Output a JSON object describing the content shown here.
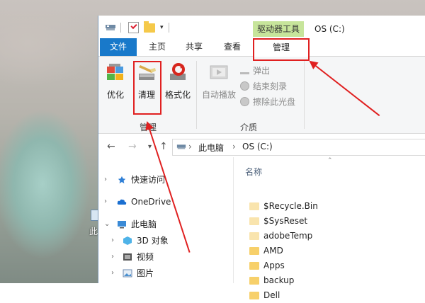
{
  "desktop": {
    "icon_label": "此电脑"
  },
  "titlebar": {
    "context_tab_label": "驱动器工具",
    "window_title": "OS (C:)",
    "qa_dropdown": "▾"
  },
  "tabs": {
    "file": "文件",
    "home": "主页",
    "share": "共享",
    "view": "查看",
    "manage": "管理"
  },
  "ribbon": {
    "group_manage": {
      "label": "管理",
      "buttons": {
        "optimize": "优化",
        "cleanup": "清理",
        "format": "格式化"
      }
    },
    "group_media": {
      "label": "介质",
      "autoplay": "自动播放",
      "eject": "弹出",
      "finish_burn": "结束刻录",
      "erase_disc": "擦除此光盘"
    }
  },
  "addressbar": {
    "back": "←",
    "forward": "→",
    "recent": "▾",
    "up": "↑",
    "crumbs": [
      "此电脑",
      "OS (C:)"
    ],
    "separator": "›"
  },
  "navpane": {
    "items": [
      {
        "label": "快速访问",
        "icon": "star-icon"
      },
      {
        "label": "OneDrive",
        "icon": "cloud-icon"
      },
      {
        "label": "此电脑",
        "icon": "computer-icon"
      },
      {
        "label": "3D 对象",
        "icon": "3d-objects-icon"
      },
      {
        "label": "视频",
        "icon": "video-icon"
      },
      {
        "label": "图片",
        "icon": "pictures-icon"
      }
    ]
  },
  "filepane": {
    "column_header": "名称",
    "files": [
      "$Recycle.Bin",
      "$SysReset",
      "adobeTemp",
      "AMD",
      "Apps",
      "backup",
      "Dell"
    ]
  },
  "colors": {
    "file_tab": "#1979ca",
    "context_tab": "#c7e59b",
    "annotation_red": "#e02020"
  }
}
